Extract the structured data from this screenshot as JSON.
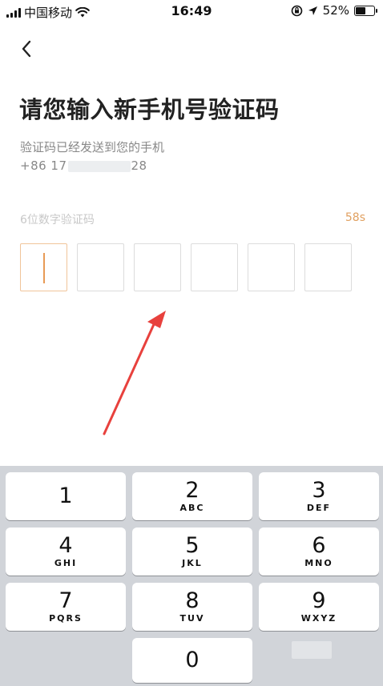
{
  "status_bar": {
    "carrier": "中国移动",
    "time": "16:49",
    "battery_percent": "52%",
    "battery_level": 0.52,
    "icons": [
      "signal-icon",
      "wifi-icon",
      "orientation-lock-icon",
      "location-icon",
      "battery-icon"
    ]
  },
  "header": {
    "back_icon": "chevron-left-icon"
  },
  "main": {
    "title": "请您输入新手机号验证码",
    "subtitle": "验证码已经发送到您的手机",
    "phone_prefix": "+86 17",
    "phone_suffix": "28",
    "code_label": "6位数字验证码",
    "countdown": "58s",
    "code_length": 6,
    "accent_color": "#e89a55"
  },
  "keyboard": {
    "keys": [
      {
        "num": "1",
        "letters": ""
      },
      {
        "num": "2",
        "letters": "ABC"
      },
      {
        "num": "3",
        "letters": "DEF"
      },
      {
        "num": "4",
        "letters": "GHI"
      },
      {
        "num": "5",
        "letters": "JKL"
      },
      {
        "num": "6",
        "letters": "MNO"
      },
      {
        "num": "7",
        "letters": "PQRS"
      },
      {
        "num": "8",
        "letters": "TUV"
      },
      {
        "num": "9",
        "letters": "WXYZ"
      },
      {
        "num": "0",
        "letters": ""
      }
    ]
  }
}
